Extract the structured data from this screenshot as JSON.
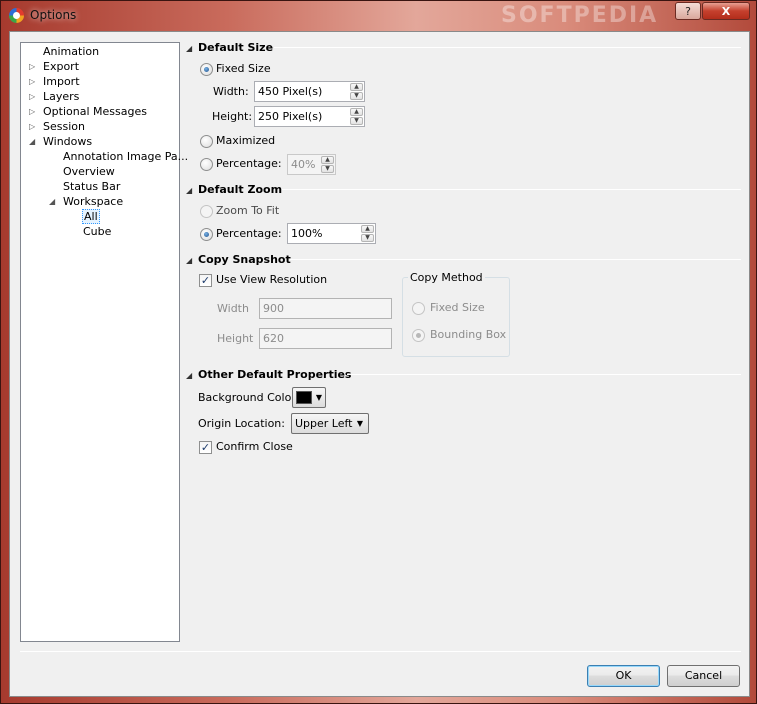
{
  "window": {
    "title": "Options",
    "watermark": "SOFTPEDIA",
    "help_label": "?",
    "close_label": "X"
  },
  "tree": {
    "items": [
      {
        "label": "Animation"
      },
      {
        "label": "Export",
        "toggle": "▷"
      },
      {
        "label": "Import",
        "toggle": "▷"
      },
      {
        "label": "Layers",
        "toggle": "▷"
      },
      {
        "label": "Optional Messages",
        "toggle": "▷"
      },
      {
        "label": "Session",
        "toggle": "▷"
      },
      {
        "label": "Windows",
        "toggle": "◢"
      },
      {
        "label": "Annotation Image Pa..."
      },
      {
        "label": "Overview"
      },
      {
        "label": "Status Bar"
      },
      {
        "label": "Workspace",
        "toggle": "◢"
      },
      {
        "label": "All",
        "selected": true
      },
      {
        "label": "Cube"
      }
    ]
  },
  "default_size": {
    "header": "Default Size",
    "fixed_size_label": "Fixed Size",
    "width_label": "Width:",
    "width_value": "450 Pixel(s)",
    "height_label": "Height:",
    "height_value": "250 Pixel(s)",
    "maximized_label": "Maximized",
    "percentage_label": "Percentage:",
    "percentage_value": "40%"
  },
  "default_zoom": {
    "header": "Default Zoom",
    "zoom_to_fit_label": "Zoom To Fit",
    "percentage_label": "Percentage:",
    "percentage_value": "100%"
  },
  "copy_snapshot": {
    "header": "Copy Snapshot",
    "use_view_resolution_label": "Use View Resolution",
    "use_view_resolution_checked": true,
    "width_label": "Width",
    "width_value": "900",
    "height_label": "Height",
    "height_value": "620",
    "copy_method_label": "Copy Method",
    "fixed_size_label": "Fixed Size",
    "bounding_box_label": "Bounding Box"
  },
  "other_props": {
    "header": "Other Default Properties",
    "background_color_label": "Background Color:",
    "background_color": "#000000",
    "origin_location_label": "Origin Location:",
    "origin_location_value": "Upper Left",
    "confirm_close_label": "Confirm Close",
    "confirm_close_checked": true
  },
  "buttons": {
    "ok_label": "OK",
    "cancel_label": "Cancel"
  },
  "glyphs": {
    "check": "✓",
    "spin_up": "▲",
    "spin_down": "▼",
    "combo_arrow": "▼",
    "group_arrow": "◢"
  }
}
